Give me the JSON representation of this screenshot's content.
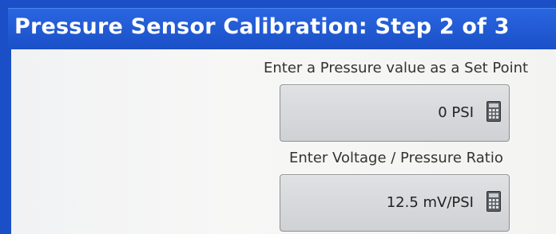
{
  "header": {
    "title": "Pressure Sensor Calibration:  Step 2 of 3"
  },
  "fields": [
    {
      "label": "Enter a Pressure value as a Set Point",
      "value": "0 PSI",
      "icon": "calculator-icon"
    },
    {
      "label": "Enter Voltage / Pressure Ratio",
      "value": "12.5 mV/PSI",
      "icon": "calculator-icon"
    }
  ],
  "colors": {
    "title_bar": "#1f58d6",
    "title_text": "#ffffff",
    "background": "#f4f4f3",
    "field_box": "#d6d8db"
  }
}
